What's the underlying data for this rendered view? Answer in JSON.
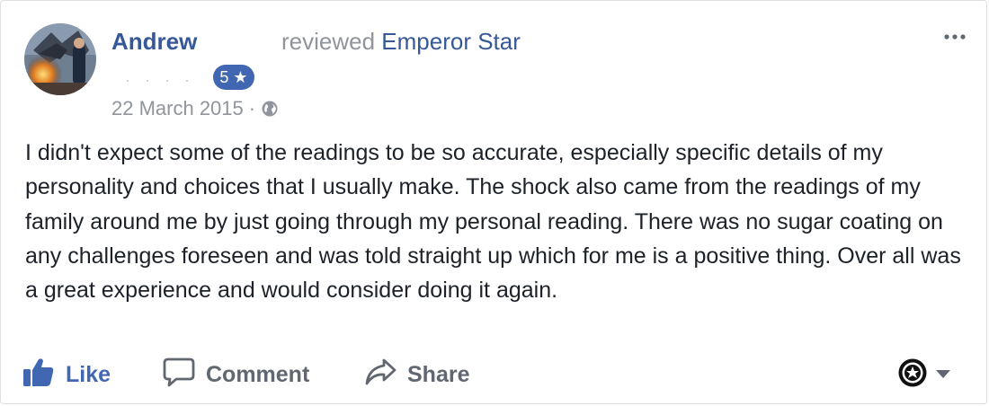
{
  "review": {
    "author": "Andrew",
    "action_prefix": "reviewed",
    "page_name": "Emperor Star",
    "rating_label": "5 ★",
    "rating_value": 5,
    "date": "22 March 2015",
    "separator": "·",
    "body": "I didn't expect some of the readings to be so accurate, especially specific details of my personality and choices that I usually make. The shock also came from the readings of my family around me by just going through my personal reading. There was no sugar coating on any challenges foreseen and was told straight up which for me is a positive thing. Over all was a great experience and would consider doing it again."
  },
  "actions": {
    "like": "Like",
    "comment": "Comment",
    "share": "Share"
  },
  "icons": {
    "avatar": "profile-photo",
    "globe": "globe-icon",
    "more": "more-options-icon",
    "like": "thumbs-up-icon",
    "comment": "comment-bubble-icon",
    "share": "share-arrow-icon",
    "audience": "page-avatar-icon",
    "caret": "caret-down-icon"
  },
  "colors": {
    "link": "#365899",
    "like_active": "#4267b2",
    "muted": "#90949c",
    "action_gray": "#606770",
    "body_text": "#1d2129"
  }
}
